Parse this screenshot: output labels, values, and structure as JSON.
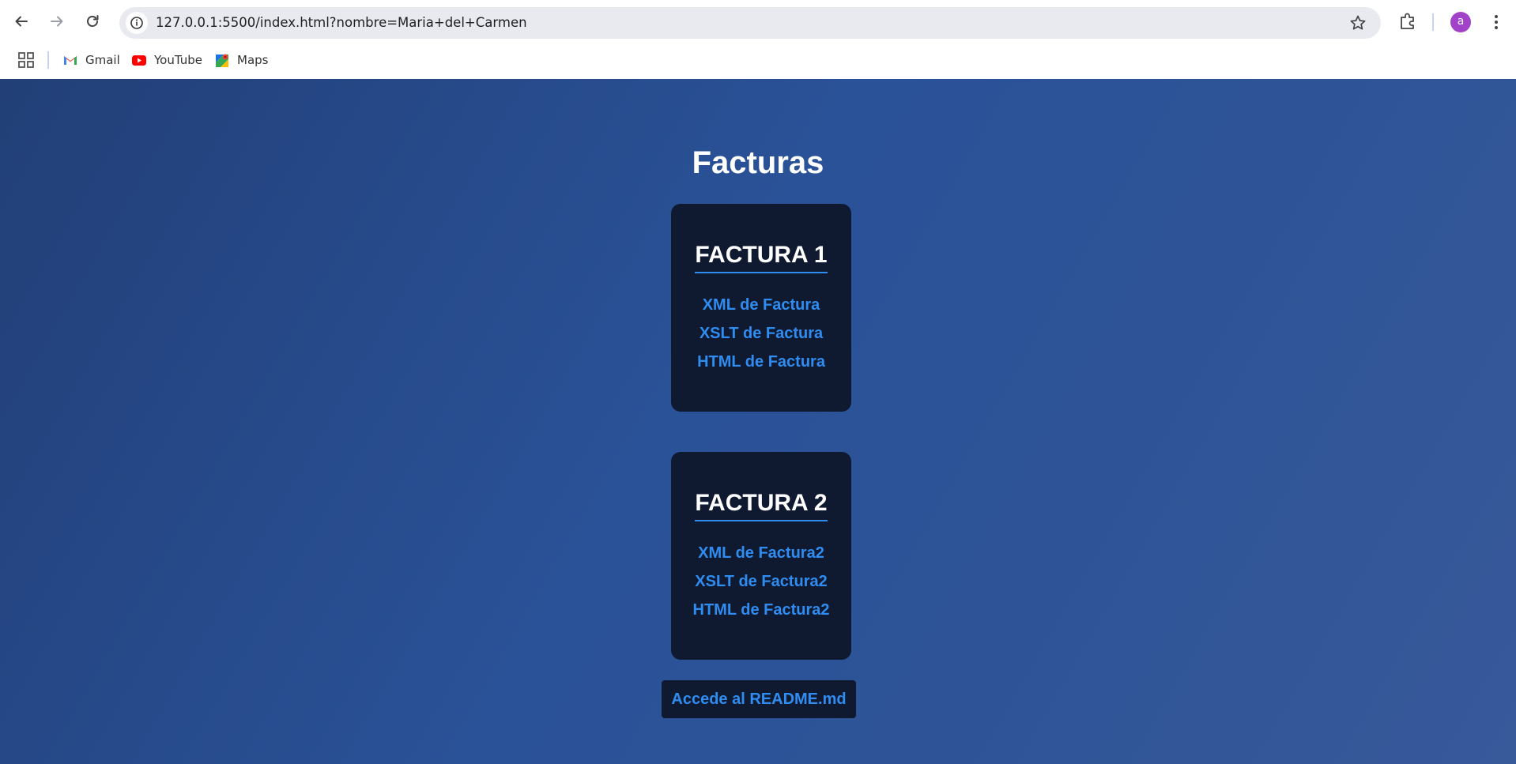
{
  "browser": {
    "url": "127.0.0.1:5500/index.html?nombre=Maria+del+Carmen",
    "avatar_letter": "a",
    "bookmarks": [
      {
        "label": "Gmail",
        "icon": "gmail-icon"
      },
      {
        "label": "YouTube",
        "icon": "youtube-icon"
      },
      {
        "label": "Maps",
        "icon": "maps-icon"
      }
    ]
  },
  "page": {
    "title": "Facturas",
    "cards": [
      {
        "title": "FACTURA 1",
        "links": [
          "XML de Factura",
          "XSLT de Factura",
          "HTML de Factura"
        ]
      },
      {
        "title": "FACTURA 2",
        "links": [
          "XML de Factura2",
          "XSLT de Factura2",
          "HTML de Factura2"
        ]
      }
    ],
    "readme_link": "Accede al README.md"
  },
  "colors": {
    "card_background": "#0f1a31",
    "link_color": "#2f8cf0",
    "page_gradient_start": "#223f77",
    "page_gradient_end": "#38599a",
    "avatar": "#a142c9"
  }
}
